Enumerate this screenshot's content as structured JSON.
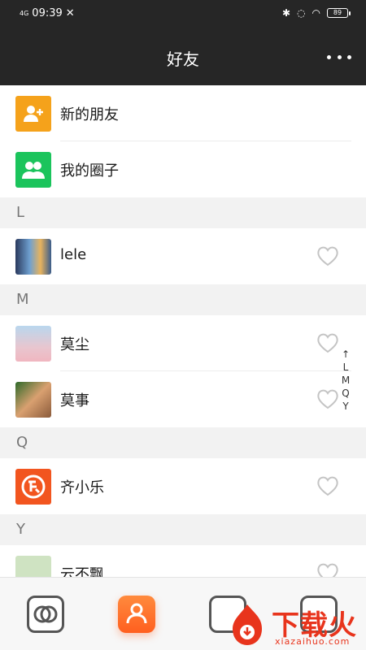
{
  "status_bar": {
    "network": "4G",
    "time": "09:39",
    "battery": "89"
  },
  "header": {
    "title": "好友"
  },
  "fixed_items": [
    {
      "label": "新的朋友",
      "icon": "add-friend-icon",
      "color": "#f5a21b"
    },
    {
      "label": "我的圈子",
      "icon": "group-icon",
      "color": "#1bc45c"
    }
  ],
  "sections": [
    {
      "letter": "L",
      "contacts": [
        {
          "name": "lele"
        }
      ]
    },
    {
      "letter": "M",
      "contacts": [
        {
          "name": "莫尘"
        },
        {
          "name": "莫事"
        }
      ]
    },
    {
      "letter": "Q",
      "contacts": [
        {
          "name": "齐小乐"
        }
      ]
    },
    {
      "letter": "Y",
      "contacts": [
        {
          "name": "云不飘"
        }
      ]
    }
  ],
  "index_bar": [
    "↑",
    "L",
    "M",
    "Q",
    "Y"
  ],
  "watermark": {
    "text": "下载火",
    "sub": "xiazaihuo.com"
  },
  "colors": {
    "accent": "#ff6a2a",
    "header_bg": "#262626"
  }
}
